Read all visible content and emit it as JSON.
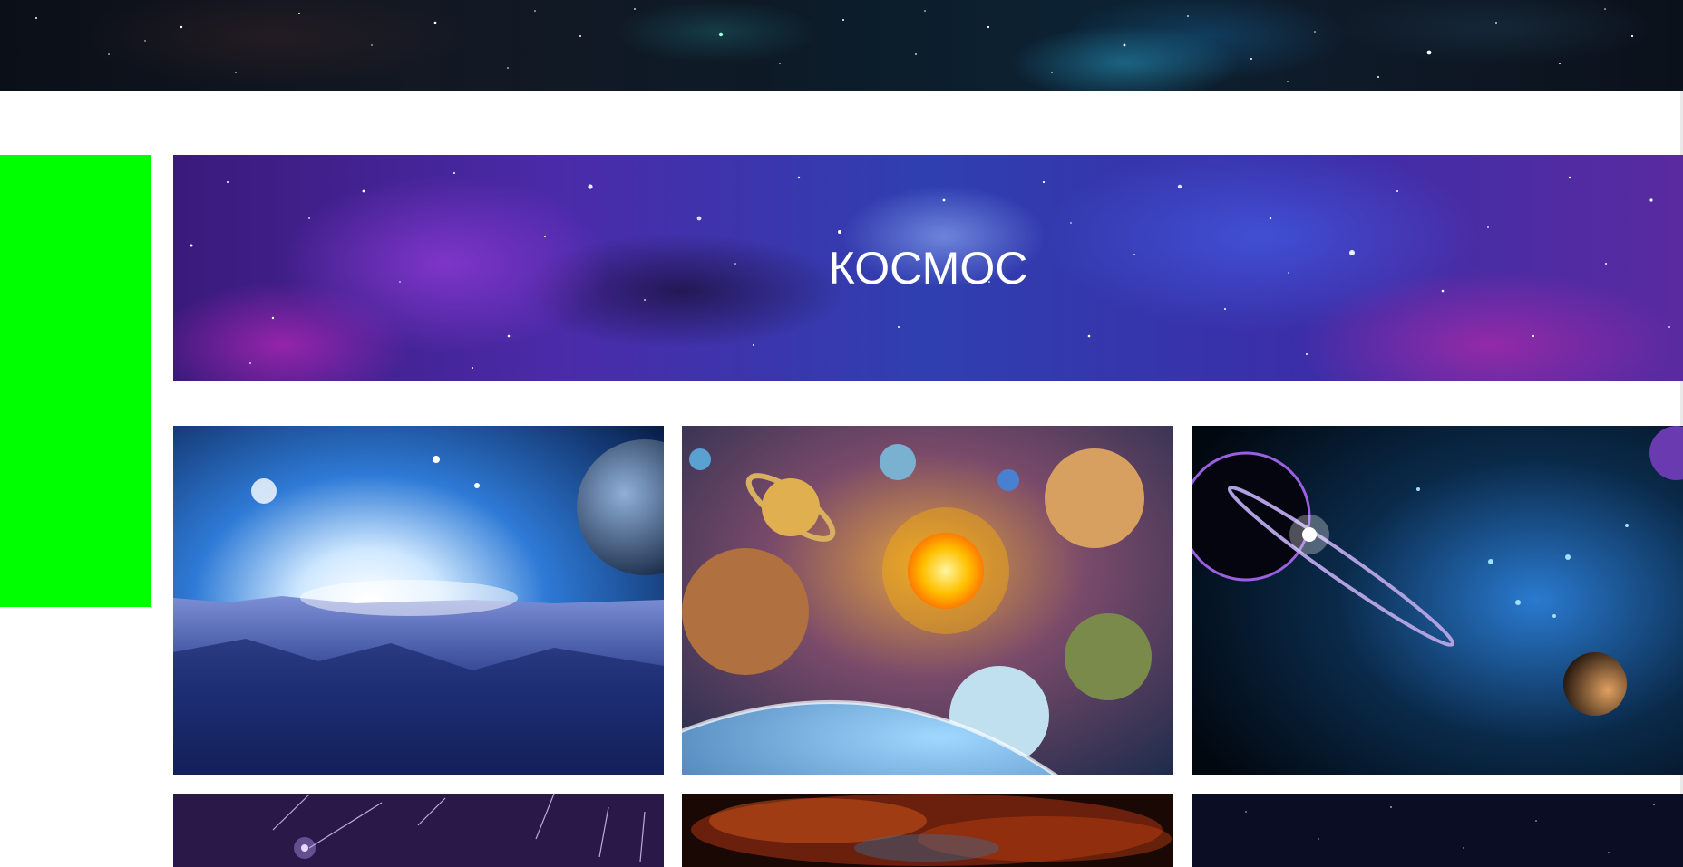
{
  "banner": {
    "title": "КОСМОС"
  },
  "gallery": {
    "items": [
      {
        "icon": "alien-planet-sunrise-image"
      },
      {
        "icon": "solar-system-planets-image"
      },
      {
        "icon": "ringed-planet-nebula-image"
      },
      {
        "icon": "meteor-shower-image"
      },
      {
        "icon": "orange-nebula-image"
      },
      {
        "icon": "dark-starfield-image"
      }
    ]
  },
  "colors": {
    "sidebar_block": "#00ff00",
    "page_background": "#ffffff",
    "banner_text": "#ffffff"
  }
}
